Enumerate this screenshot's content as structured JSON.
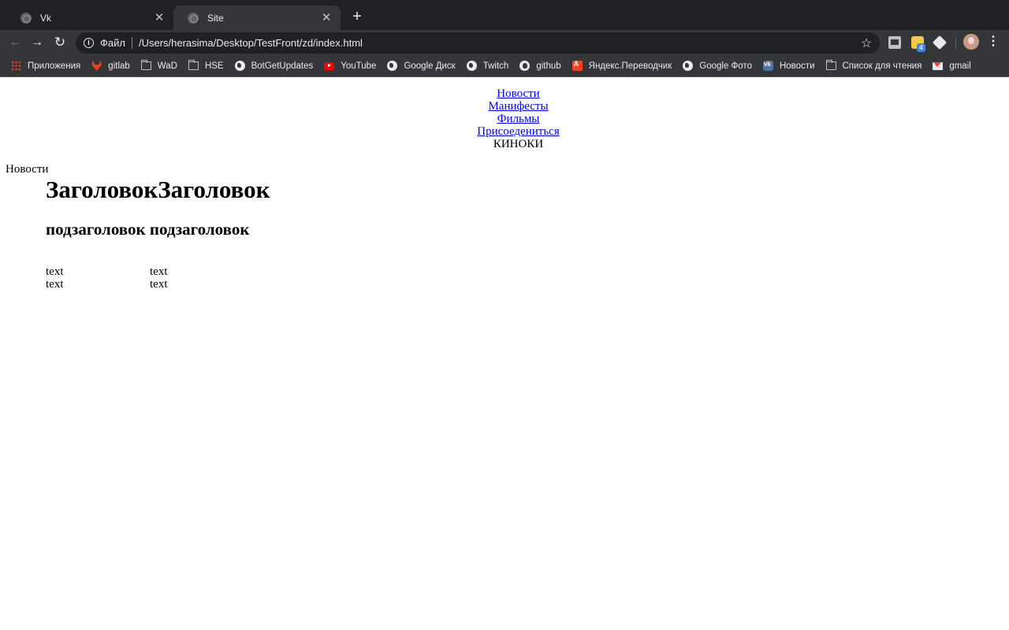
{
  "browser": {
    "tabs": [
      {
        "title": "Vk",
        "active": false
      },
      {
        "title": "Site",
        "active": true
      }
    ],
    "address_bar": {
      "scheme_label": "Файл",
      "url": "/Users/herasima/Desktop/TestFront/zd/index.html"
    },
    "extensions": {
      "badge_count": "4"
    },
    "bookmarks": [
      {
        "label": "Приложения",
        "icon": "apps-icon"
      },
      {
        "label": "gitlab",
        "icon": "gitlab-icon"
      },
      {
        "label": "WaD",
        "icon": "folder-icon"
      },
      {
        "label": "HSE",
        "icon": "folder-icon"
      },
      {
        "label": "BotGetUpdates",
        "icon": "globe-icon"
      },
      {
        "label": "YouTube",
        "icon": "youtube-icon"
      },
      {
        "label": "Google Диск",
        "icon": "globe-icon"
      },
      {
        "label": "Twitch",
        "icon": "globe-icon"
      },
      {
        "label": "github",
        "icon": "github-icon"
      },
      {
        "label": "Яндекс.Переводчик",
        "icon": "translate-icon"
      },
      {
        "label": "Google Фото",
        "icon": "globe-icon"
      },
      {
        "label": "Новости",
        "icon": "vk-icon"
      },
      {
        "label": "Список для чтения",
        "icon": "folder-icon"
      },
      {
        "label": "gmail",
        "icon": "gmail-icon"
      }
    ]
  },
  "page": {
    "nav_links": [
      "Новости",
      "Манифесты",
      "Фильмы",
      "Присоедениться"
    ],
    "brand": "КИНОКИ",
    "section_label": "Новости",
    "heading": "ЗаголовокЗаголовок",
    "subheading": "подзаголовок подзаголовок",
    "table": [
      [
        "text",
        "text"
      ],
      [
        "text",
        "text"
      ]
    ]
  }
}
